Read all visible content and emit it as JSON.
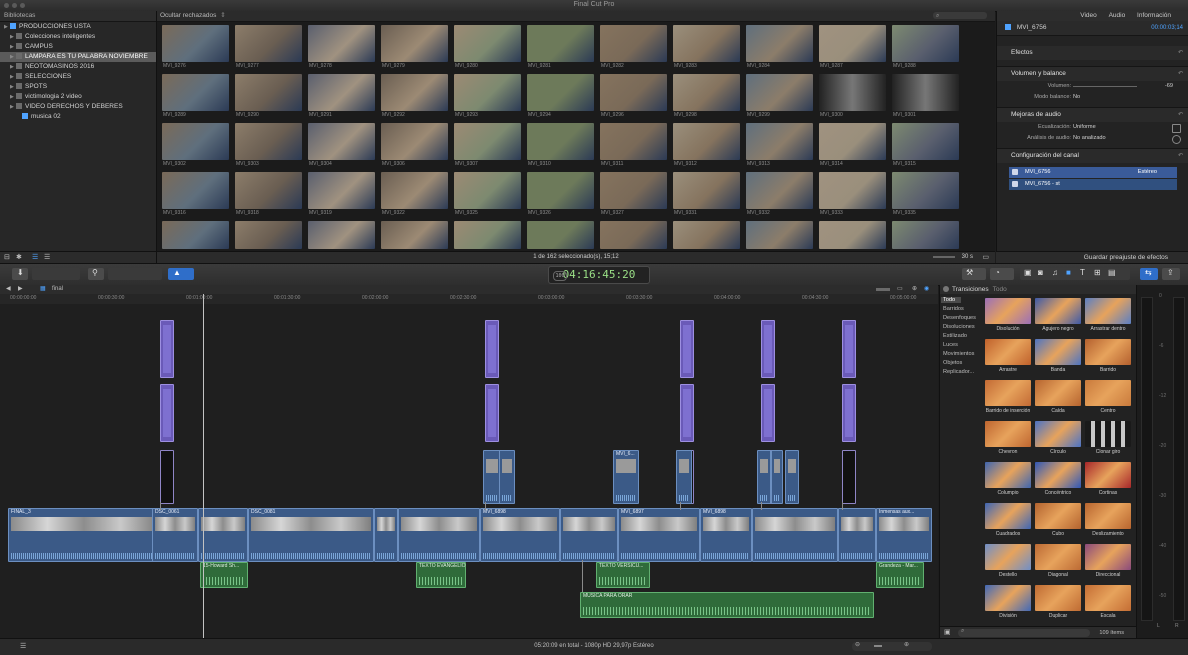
{
  "window": {
    "title": "Final Cut Pro"
  },
  "library": {
    "header": "Bibliotecas",
    "items": [
      {
        "label": "PRODUCCIONES USTA",
        "level": 0
      },
      {
        "label": "Colecciones inteligentes",
        "level": 1
      },
      {
        "label": "CAMPUS",
        "level": 1
      },
      {
        "label": "LAMPARA ES TU PALABRA NOVIEMBRE",
        "level": 1,
        "selected": true
      },
      {
        "label": "NEOTOMASINOS 2016",
        "level": 1
      },
      {
        "label": "SELECCIONES",
        "level": 1
      },
      {
        "label": "SPOTS",
        "level": 1
      },
      {
        "label": "victimologia 2 video",
        "level": 1
      },
      {
        "label": "VIDEO DERECHOS Y DEBERES",
        "level": 1
      },
      {
        "label": "musica 02",
        "level": 2
      }
    ]
  },
  "browser": {
    "filter_label": "Ocultar rechazados",
    "selection_status": "1 de 162 seleccionado(s), 15;12",
    "zoom_label": "30 s",
    "thumbs": [
      "MVI_9276",
      "MVI_9277",
      "MVI_9278",
      "MVI_9279",
      "MVI_9280",
      "MVI_9281",
      "MVI_9282",
      "MVI_9283",
      "MVI_9284",
      "MVI_9287",
      "MVI_9288",
      "MVI_9289",
      "MVI_9290",
      "MVI_9291",
      "MVI_9292",
      "MVI_9293",
      "MVI_9294",
      "MVI_9296",
      "MVI_9298",
      "MVI_9299",
      "MVI_9300",
      "MVI_9301",
      "MVI_9302",
      "MVI_9303",
      "MVI_9304",
      "MVI_9306",
      "MVI_9307",
      "MVI_9310",
      "MVI_9311",
      "MVI_9312",
      "MVI_9313",
      "MVI_9314",
      "MVI_9315",
      "MVI_9316",
      "MVI_9318",
      "MVI_9319",
      "MVI_9322",
      "MVI_9325",
      "MVI_9326",
      "MVI_9327",
      "MVI_9331",
      "MVI_9332",
      "MVI_9333",
      "MVI_9335",
      "",
      "",
      "",
      "",
      "",
      "",
      "",
      "",
      "",
      "",
      ""
    ]
  },
  "inspector": {
    "tabs": [
      "Video",
      "Audio",
      "Información"
    ],
    "clip_name": "MVI_6756",
    "clip_timecode": "00:00:03;14",
    "sections": {
      "effects": "Efectos",
      "volume_pan": "Volumen y balance",
      "audio_enhance": "Mejoras de audio",
      "channel_config": "Configuración del canal"
    },
    "rows": {
      "volume_label": "Volumen:",
      "volume_value": "-69",
      "pan_mode_label": "Modo balance:",
      "pan_mode_value": "No",
      "eq_label": "Ecualización:",
      "eq_value": "Uniforme",
      "analysis_label": "Análisis de audio:",
      "analysis_value": "No analizado"
    },
    "channel": {
      "clip": "MVI_6756",
      "mode": "Estéreo",
      "sub": "MVI_6756 - st"
    },
    "save_preset": "Guardar preajuste de efectos"
  },
  "toolbar": {
    "timecode": "04:16:45:20",
    "timecode_badge": "100"
  },
  "timeline": {
    "project_name": "final",
    "ruler": [
      "00:00:00:00",
      "00:00:30:00",
      "00:01:00:00",
      "00:01:30:00",
      "00:02:00:00",
      "00:02:30:00",
      "00:03:00:00",
      "00:03:30:00",
      "00:04:00:00",
      "00:04:30:00",
      "00:05:00:00"
    ],
    "clip_labels": {
      "main1": "FINAL_3",
      "main2": "DSC_0061",
      "main3": "DSC_0081",
      "main4": "MVI_6898",
      "main5": "MVI_6897",
      "main6": "MVI_6898",
      "main7": "Inmensas aux...",
      "conn1": "MVI_6...",
      "audio1": "15-Howard Sh...",
      "audio2": "TEXTO EVANGELIO",
      "audio3": "TEXTO VERSICU...",
      "audio4": "Grandeza - Mar...",
      "music": "MUSICA PARA ORAR"
    }
  },
  "transitions": {
    "title": "Transiciones",
    "filter": "Todo",
    "categories": [
      "Todo",
      "Barridos",
      "Desenfoques",
      "Disoluciones",
      "Estilizado",
      "Luces",
      "Movimientos",
      "Objetos",
      "Replicador..."
    ],
    "items": [
      {
        "name": "Disolución",
        "color": "#9b6fb8"
      },
      {
        "name": "Agujero negro",
        "color": "#3d5aa8"
      },
      {
        "name": "Arrastrar dentro",
        "color": "#5a7fc4"
      },
      {
        "name": "Arrastre",
        "color": "#c0612b"
      },
      {
        "name": "Banda",
        "color": "#4d74c2"
      },
      {
        "name": "Barrido",
        "color": "#b4602e"
      },
      {
        "name": "Barrido de inserción",
        "color": "#c36a34"
      },
      {
        "name": "Caída",
        "color": "#b6642f"
      },
      {
        "name": "Centro",
        "color": "#c97a3c"
      },
      {
        "name": "Chevron",
        "color": "#bf6630"
      },
      {
        "name": "Círculo",
        "color": "#4b73c6"
      },
      {
        "name": "Clonar giro",
        "color": "#202020"
      },
      {
        "name": "Columpio",
        "color": "#3f66b0"
      },
      {
        "name": "Concéntrico",
        "color": "#2f58b8"
      },
      {
        "name": "Cortinas",
        "color": "#a8272a"
      },
      {
        "name": "Cuadrados",
        "color": "#3e66b5"
      },
      {
        "name": "Cubo",
        "color": "#b3632f"
      },
      {
        "name": "Deslizamiento",
        "color": "#b8652f"
      },
      {
        "name": "Destello",
        "color": "#6f8fc8"
      },
      {
        "name": "Diagonal",
        "color": "#bc6a34"
      },
      {
        "name": "Direccional",
        "color": "#8a4a7c"
      },
      {
        "name": "División",
        "color": "#4169b8"
      },
      {
        "name": "Duplicar",
        "color": "#bf6b33"
      },
      {
        "name": "Escala",
        "color": "#c46d34"
      }
    ],
    "count": "109 ítems"
  },
  "meters": {
    "labels": [
      "0",
      "-6",
      "-12",
      "-20",
      "-30",
      "-40",
      "-50"
    ],
    "footer": [
      "L",
      "R"
    ]
  },
  "status": {
    "text": "05:20:09 en total - 1080p HD 29,97p Estéreo"
  }
}
